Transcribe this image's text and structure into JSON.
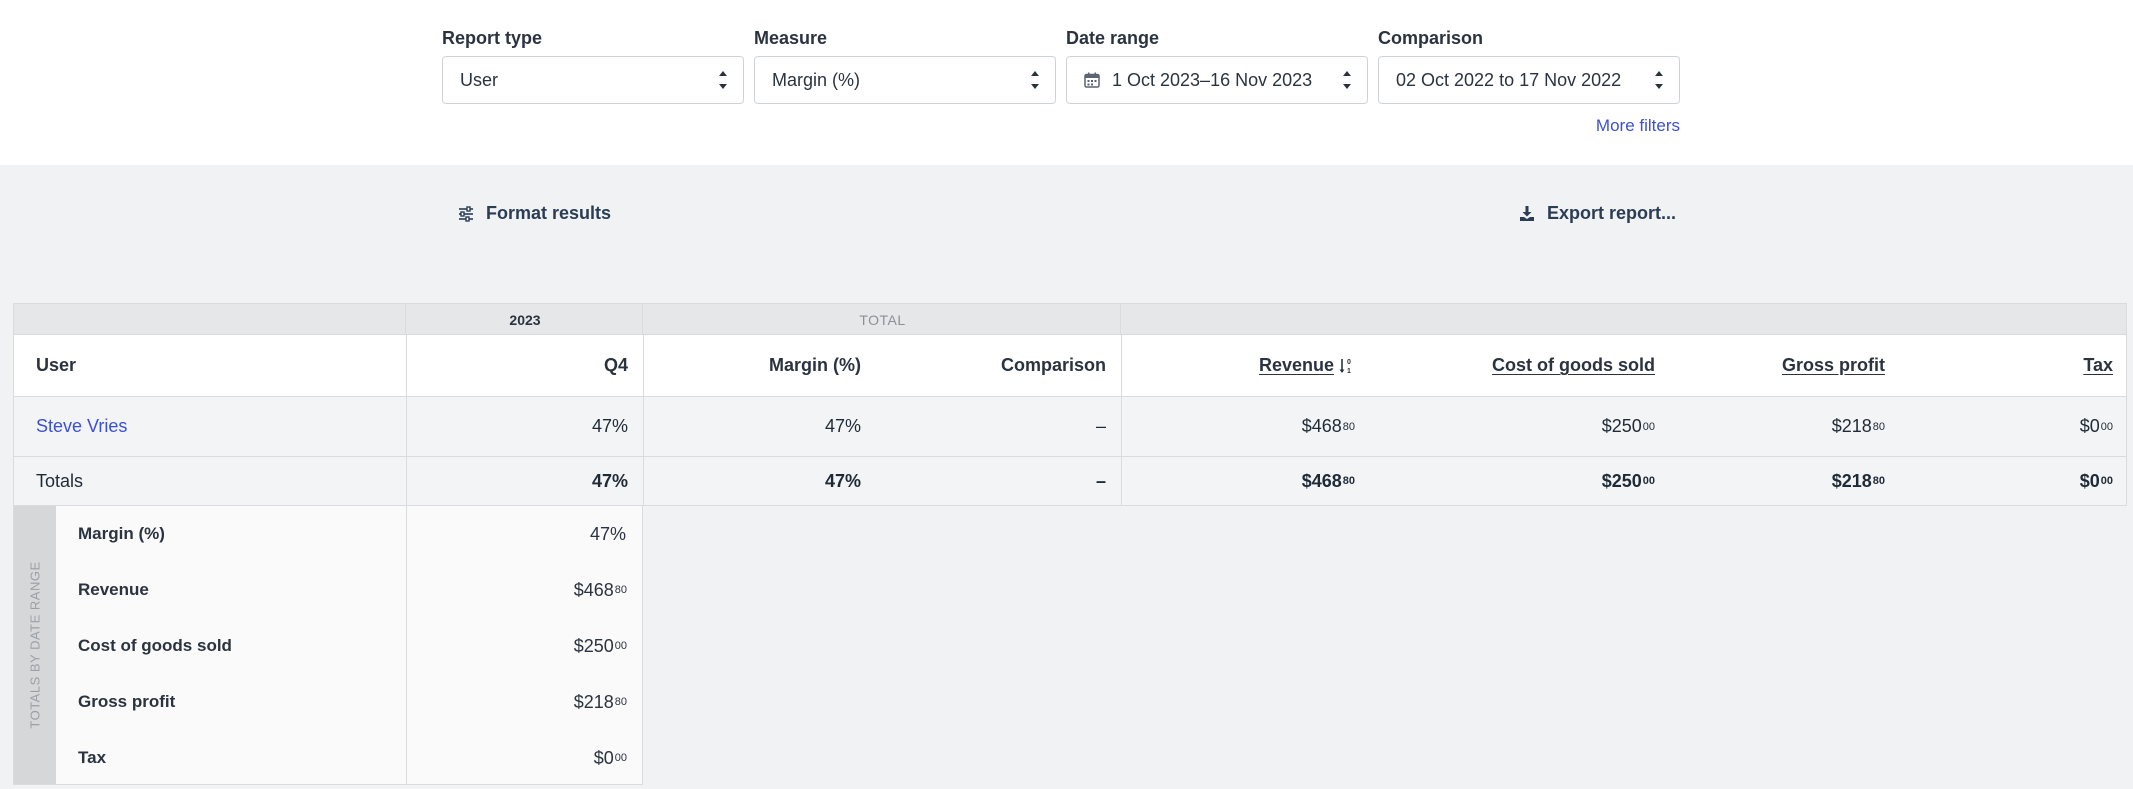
{
  "filters": {
    "report_type": {
      "label": "Report type",
      "value": "User"
    },
    "measure": {
      "label": "Measure",
      "value": "Margin (%)"
    },
    "date_range": {
      "label": "Date range",
      "value": "1 Oct 2023–16 Nov 2023"
    },
    "comparison": {
      "label": "Comparison",
      "value": "02 Oct 2022 to 17 Nov 2022"
    },
    "more_filters": "More filters"
  },
  "toolbar": {
    "format_results": "Format results",
    "export_report": "Export report..."
  },
  "table": {
    "group_headers": {
      "year": "2023",
      "total": "TOTAL"
    },
    "columns": {
      "user": "User",
      "q4": "Q4",
      "margin": "Margin (%)",
      "comparison": "Comparison",
      "revenue": "Revenue",
      "cogs": "Cost of goods sold",
      "gross_profit": "Gross profit",
      "tax": "Tax"
    },
    "rows": [
      {
        "user": "Steve Vries",
        "q4": "47%",
        "margin": "47%",
        "comparison": "–",
        "revenue": {
          "main": "$468",
          "cents": "80"
        },
        "cogs": {
          "main": "$250",
          "cents": "00"
        },
        "gross_profit": {
          "main": "$218",
          "cents": "80"
        },
        "tax": {
          "main": "$0",
          "cents": "00"
        }
      }
    ],
    "totals": {
      "label": "Totals",
      "q4": "47%",
      "margin": "47%",
      "comparison": "–",
      "revenue": {
        "main": "$468",
        "cents": "80"
      },
      "cogs": {
        "main": "$250",
        "cents": "00"
      },
      "gross_profit": {
        "main": "$218",
        "cents": "80"
      },
      "tax": {
        "main": "$0",
        "cents": "00"
      }
    }
  },
  "totals_by_date_range": {
    "title": "TOTALS BY DATE RANGE",
    "items": [
      {
        "label": "Margin (%)",
        "main": "47%",
        "cents": ""
      },
      {
        "label": "Revenue",
        "main": "$468",
        "cents": "80"
      },
      {
        "label": "Cost of goods sold",
        "main": "$250",
        "cents": "00"
      },
      {
        "label": "Gross profit",
        "main": "$218",
        "cents": "80"
      },
      {
        "label": "Tax",
        "main": "$0",
        "cents": "00"
      }
    ]
  },
  "icons": {
    "format": "sliders-icon",
    "export": "download-icon",
    "calendar": "calendar-icon",
    "sort": "sort-numeric-icon",
    "spinner": "updown-chevron-icon"
  },
  "colors": {
    "accent_link": "#3b4fd8",
    "header_bg": "#e6e7e9",
    "page_bg": "#f1f2f4"
  }
}
